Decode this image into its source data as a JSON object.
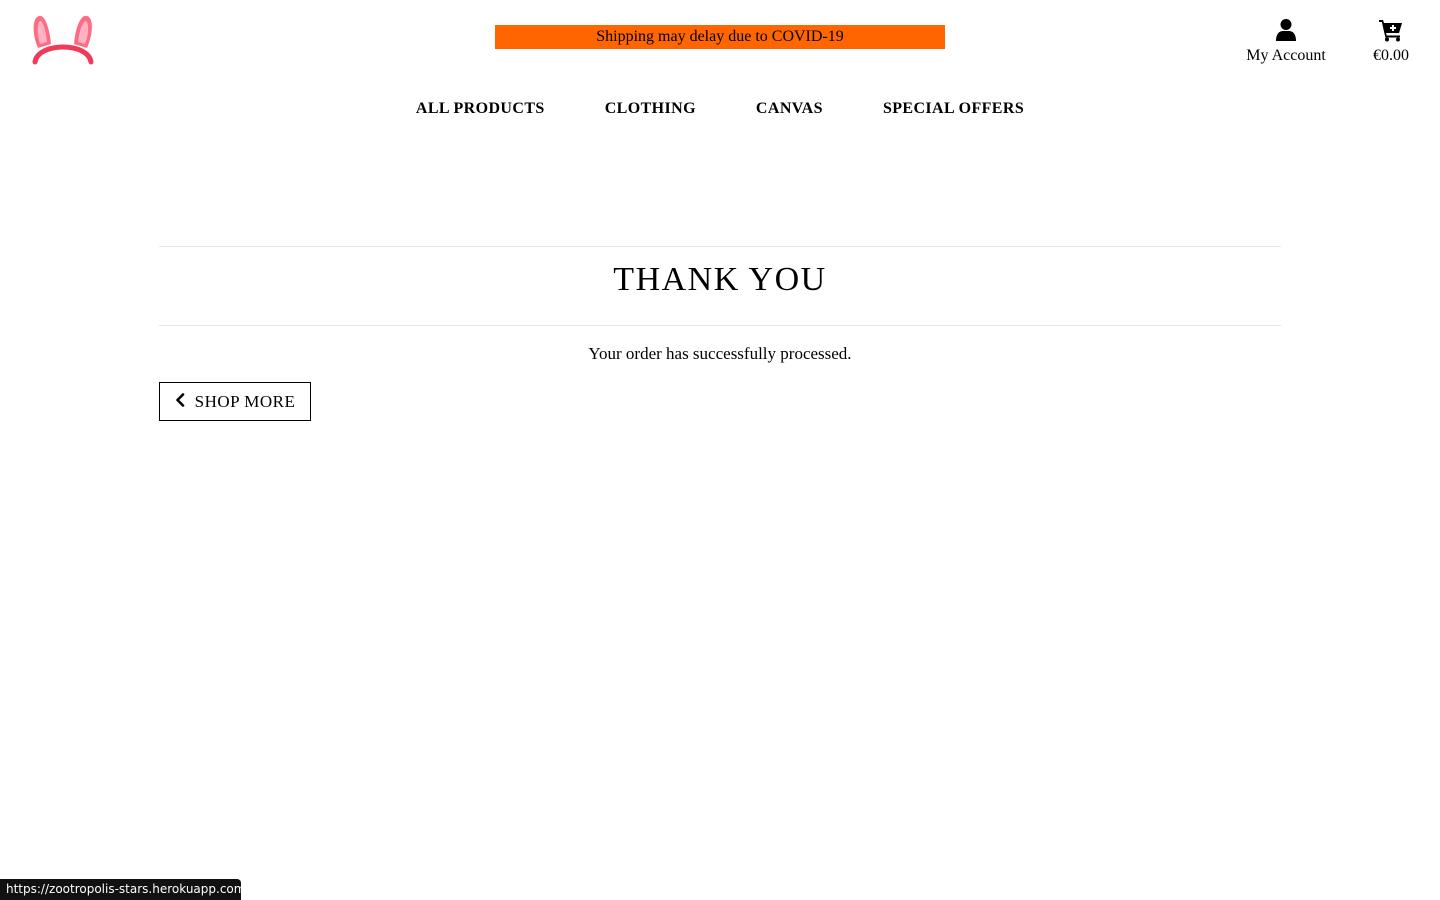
{
  "header": {
    "logo_icon": "bunny-ears-headband-icon",
    "banner_text": "Shipping may delay due to COVID-19",
    "banner_color": "#ff6600",
    "account_icon": "user-icon",
    "account_label": "My Account",
    "cart_icon": "shopping-cart-icon",
    "cart_total": "€0.00"
  },
  "nav": {
    "items": [
      {
        "label": "ALL PRODUCTS"
      },
      {
        "label": "CLOTHING"
      },
      {
        "label": "CANVAS"
      },
      {
        "label": "SPECIAL OFFERS"
      }
    ]
  },
  "main": {
    "title": "THANK YOU",
    "message": "Your order has successfully processed.",
    "shop_more_label": "SHOP MORE",
    "shop_more_icon": "chevron-left-icon"
  },
  "status_bar": {
    "url": "https://zootropolis-stars.herokuapp.com"
  },
  "colors": {
    "accent": "#ff6600",
    "logo_pink": "#ff4f6e",
    "text": "#000000",
    "divider": "#e6e6e6"
  }
}
